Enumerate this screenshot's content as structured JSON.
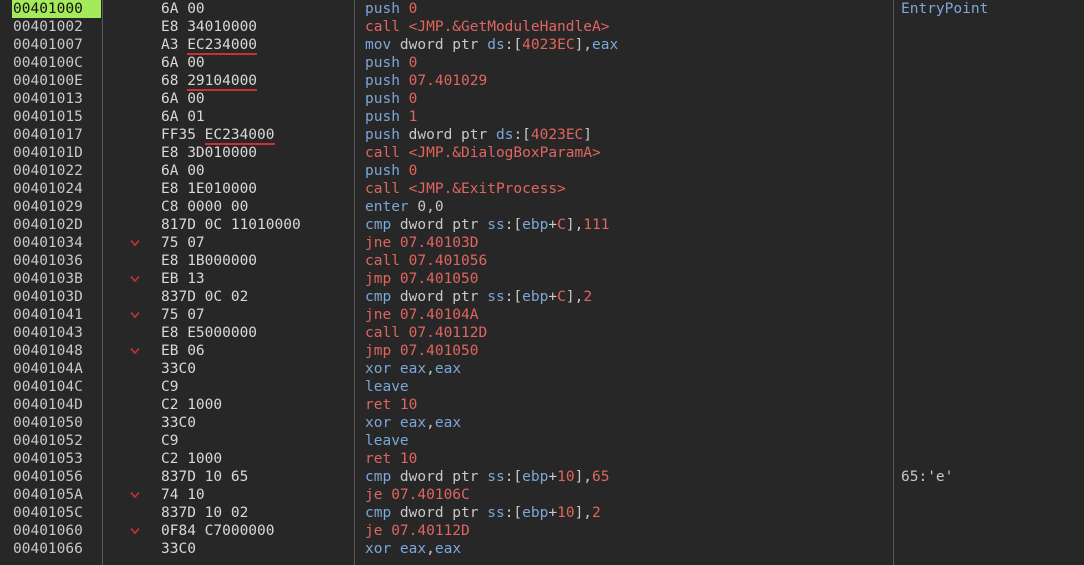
{
  "rows": [
    {
      "addr": "00401000",
      "selected": true,
      "arrow": "",
      "bytes": [
        {
          "t": "6A 00"
        }
      ],
      "instr": [
        {
          "t": "push ",
          "c": "t-mn-blue"
        },
        {
          "t": "0",
          "c": "t-num"
        }
      ],
      "comment": "EntryPoint",
      "comment_class": "ep"
    },
    {
      "addr": "00401002",
      "arrow": "",
      "bytes": [
        {
          "t": "E8 34010000"
        }
      ],
      "instr": [
        {
          "t": "call ",
          "c": "t-mn-red"
        },
        {
          "t": "<JMP.&GetModuleHandleA>",
          "c": "t-sym"
        }
      ],
      "comment": ""
    },
    {
      "addr": "00401007",
      "arrow": "",
      "bytes": [
        {
          "t": "A3 "
        },
        {
          "t": "EC234000",
          "u": true
        }
      ],
      "instr": [
        {
          "t": "mov ",
          "c": "t-mn-blue"
        },
        {
          "t": "dword ptr ",
          "c": "t-kw"
        },
        {
          "t": "ds",
          "c": "t-seg"
        },
        {
          "t": ":[",
          "c": "t-plain"
        },
        {
          "t": "4023EC",
          "c": "t-num"
        },
        {
          "t": "],",
          "c": "t-plain"
        },
        {
          "t": "eax",
          "c": "t-reg"
        }
      ],
      "comment": ""
    },
    {
      "addr": "0040100C",
      "arrow": "",
      "bytes": [
        {
          "t": "6A 00"
        }
      ],
      "instr": [
        {
          "t": "push ",
          "c": "t-mn-blue"
        },
        {
          "t": "0",
          "c": "t-num"
        }
      ],
      "comment": ""
    },
    {
      "addr": "0040100E",
      "arrow": "",
      "bytes": [
        {
          "t": "68 "
        },
        {
          "t": "29104000",
          "u": true
        }
      ],
      "instr": [
        {
          "t": "push ",
          "c": "t-mn-blue"
        },
        {
          "t": "07.401029",
          "c": "t-num"
        }
      ],
      "comment": ""
    },
    {
      "addr": "00401013",
      "arrow": "",
      "bytes": [
        {
          "t": "6A 00"
        }
      ],
      "instr": [
        {
          "t": "push ",
          "c": "t-mn-blue"
        },
        {
          "t": "0",
          "c": "t-num"
        }
      ],
      "comment": ""
    },
    {
      "addr": "00401015",
      "arrow": "",
      "bytes": [
        {
          "t": "6A 01"
        }
      ],
      "instr": [
        {
          "t": "push ",
          "c": "t-mn-blue"
        },
        {
          "t": "1",
          "c": "t-num"
        }
      ],
      "comment": ""
    },
    {
      "addr": "00401017",
      "arrow": "",
      "bytes": [
        {
          "t": "FF35 "
        },
        {
          "t": "EC234000",
          "u": true
        }
      ],
      "instr": [
        {
          "t": "push ",
          "c": "t-mn-blue"
        },
        {
          "t": "dword ptr ",
          "c": "t-kw"
        },
        {
          "t": "ds",
          "c": "t-seg"
        },
        {
          "t": ":[",
          "c": "t-plain"
        },
        {
          "t": "4023EC",
          "c": "t-num"
        },
        {
          "t": "]",
          "c": "t-plain"
        }
      ],
      "comment": ""
    },
    {
      "addr": "0040101D",
      "arrow": "",
      "bytes": [
        {
          "t": "E8 3D010000"
        }
      ],
      "instr": [
        {
          "t": "call ",
          "c": "t-mn-red"
        },
        {
          "t": "<JMP.&DialogBoxParamA>",
          "c": "t-sym"
        }
      ],
      "comment": ""
    },
    {
      "addr": "00401022",
      "arrow": "",
      "bytes": [
        {
          "t": "6A 00"
        }
      ],
      "instr": [
        {
          "t": "push ",
          "c": "t-mn-blue"
        },
        {
          "t": "0",
          "c": "t-num"
        }
      ],
      "comment": ""
    },
    {
      "addr": "00401024",
      "arrow": "",
      "bytes": [
        {
          "t": "E8 1E010000"
        }
      ],
      "instr": [
        {
          "t": "call ",
          "c": "t-mn-red"
        },
        {
          "t": "<JMP.&ExitProcess>",
          "c": "t-sym"
        }
      ],
      "comment": ""
    },
    {
      "addr": "00401029",
      "arrow": "",
      "bytes": [
        {
          "t": "C8 0000 00"
        }
      ],
      "instr": [
        {
          "t": "enter ",
          "c": "t-mn-blue"
        },
        {
          "t": "0,0",
          "c": "t-plain"
        }
      ],
      "comment": ""
    },
    {
      "addr": "0040102D",
      "arrow": "",
      "bytes": [
        {
          "t": "817D 0C 11010000"
        }
      ],
      "instr": [
        {
          "t": "cmp ",
          "c": "t-mn-blue"
        },
        {
          "t": "dword ptr ",
          "c": "t-kw"
        },
        {
          "t": "ss",
          "c": "t-seg"
        },
        {
          "t": ":[",
          "c": "t-plain"
        },
        {
          "t": "ebp",
          "c": "t-reg"
        },
        {
          "t": "+",
          "c": "t-plain"
        },
        {
          "t": "C",
          "c": "t-num"
        },
        {
          "t": "],",
          "c": "t-plain"
        },
        {
          "t": "111",
          "c": "t-num"
        }
      ],
      "comment": ""
    },
    {
      "addr": "00401034",
      "arrow": "v",
      "bytes": [
        {
          "t": "75 07"
        }
      ],
      "instr": [
        {
          "t": "jne ",
          "c": "t-mn-red"
        },
        {
          "t": "07.40103D",
          "c": "t-num"
        }
      ],
      "comment": ""
    },
    {
      "addr": "00401036",
      "arrow": "",
      "bytes": [
        {
          "t": "E8 1B000000"
        }
      ],
      "instr": [
        {
          "t": "call ",
          "c": "t-mn-red"
        },
        {
          "t": "07.401056",
          "c": "t-num"
        }
      ],
      "comment": ""
    },
    {
      "addr": "0040103B",
      "arrow": "v",
      "bytes": [
        {
          "t": "EB 13"
        }
      ],
      "instr": [
        {
          "t": "jmp ",
          "c": "t-mn-red"
        },
        {
          "t": "07.401050",
          "c": "t-num"
        }
      ],
      "comment": ""
    },
    {
      "addr": "0040103D",
      "arrow": "",
      "bytes": [
        {
          "t": "837D 0C 02"
        }
      ],
      "instr": [
        {
          "t": "cmp ",
          "c": "t-mn-blue"
        },
        {
          "t": "dword ptr ",
          "c": "t-kw"
        },
        {
          "t": "ss",
          "c": "t-seg"
        },
        {
          "t": ":[",
          "c": "t-plain"
        },
        {
          "t": "ebp",
          "c": "t-reg"
        },
        {
          "t": "+",
          "c": "t-plain"
        },
        {
          "t": "C",
          "c": "t-num"
        },
        {
          "t": "],",
          "c": "t-plain"
        },
        {
          "t": "2",
          "c": "t-num"
        }
      ],
      "comment": ""
    },
    {
      "addr": "00401041",
      "arrow": "v",
      "bytes": [
        {
          "t": "75 07"
        }
      ],
      "instr": [
        {
          "t": "jne ",
          "c": "t-mn-red"
        },
        {
          "t": "07.40104A",
          "c": "t-num"
        }
      ],
      "comment": ""
    },
    {
      "addr": "00401043",
      "arrow": "",
      "bytes": [
        {
          "t": "E8 E5000000"
        }
      ],
      "instr": [
        {
          "t": "call ",
          "c": "t-mn-red"
        },
        {
          "t": "07.40112D",
          "c": "t-num"
        }
      ],
      "comment": ""
    },
    {
      "addr": "00401048",
      "arrow": "v",
      "bytes": [
        {
          "t": "EB 06"
        }
      ],
      "instr": [
        {
          "t": "jmp ",
          "c": "t-mn-red"
        },
        {
          "t": "07.401050",
          "c": "t-num"
        }
      ],
      "comment": ""
    },
    {
      "addr": "0040104A",
      "arrow": "",
      "bytes": [
        {
          "t": "33C0"
        }
      ],
      "instr": [
        {
          "t": "xor ",
          "c": "t-mn-blue"
        },
        {
          "t": "eax",
          "c": "t-reg"
        },
        {
          "t": ",",
          "c": "t-plain"
        },
        {
          "t": "eax",
          "c": "t-reg"
        }
      ],
      "comment": ""
    },
    {
      "addr": "0040104C",
      "arrow": "",
      "bytes": [
        {
          "t": "C9"
        }
      ],
      "instr": [
        {
          "t": "leave",
          "c": "t-mn-blue"
        }
      ],
      "comment": ""
    },
    {
      "addr": "0040104D",
      "arrow": "",
      "bytes": [
        {
          "t": "C2 1000"
        }
      ],
      "instr": [
        {
          "t": "ret ",
          "c": "t-mn-red"
        },
        {
          "t": "10",
          "c": "t-num"
        }
      ],
      "comment": ""
    },
    {
      "addr": "00401050",
      "arrow": "",
      "bytes": [
        {
          "t": "33C0"
        }
      ],
      "instr": [
        {
          "t": "xor ",
          "c": "t-mn-blue"
        },
        {
          "t": "eax",
          "c": "t-reg"
        },
        {
          "t": ",",
          "c": "t-plain"
        },
        {
          "t": "eax",
          "c": "t-reg"
        }
      ],
      "comment": ""
    },
    {
      "addr": "00401052",
      "arrow": "",
      "bytes": [
        {
          "t": "C9"
        }
      ],
      "instr": [
        {
          "t": "leave",
          "c": "t-mn-blue"
        }
      ],
      "comment": ""
    },
    {
      "addr": "00401053",
      "arrow": "",
      "bytes": [
        {
          "t": "C2 1000"
        }
      ],
      "instr": [
        {
          "t": "ret ",
          "c": "t-mn-red"
        },
        {
          "t": "10",
          "c": "t-num"
        }
      ],
      "comment": ""
    },
    {
      "addr": "00401056",
      "arrow": "",
      "bytes": [
        {
          "t": "837D 10 65"
        }
      ],
      "instr": [
        {
          "t": "cmp ",
          "c": "t-mn-blue"
        },
        {
          "t": "dword ptr ",
          "c": "t-kw"
        },
        {
          "t": "ss",
          "c": "t-seg"
        },
        {
          "t": ":[",
          "c": "t-plain"
        },
        {
          "t": "ebp",
          "c": "t-reg"
        },
        {
          "t": "+",
          "c": "t-plain"
        },
        {
          "t": "10",
          "c": "t-num"
        },
        {
          "t": "],",
          "c": "t-plain"
        },
        {
          "t": "65",
          "c": "t-num"
        }
      ],
      "comment": "65:'e'"
    },
    {
      "addr": "0040105A",
      "arrow": "v",
      "bytes": [
        {
          "t": "74 10"
        }
      ],
      "instr": [
        {
          "t": "je ",
          "c": "t-mn-red"
        },
        {
          "t": "07.40106C",
          "c": "t-num"
        }
      ],
      "comment": ""
    },
    {
      "addr": "0040105C",
      "arrow": "",
      "bytes": [
        {
          "t": "837D 10 02"
        }
      ],
      "instr": [
        {
          "t": "cmp ",
          "c": "t-mn-blue"
        },
        {
          "t": "dword ptr ",
          "c": "t-kw"
        },
        {
          "t": "ss",
          "c": "t-seg"
        },
        {
          "t": ":[",
          "c": "t-plain"
        },
        {
          "t": "ebp",
          "c": "t-reg"
        },
        {
          "t": "+",
          "c": "t-plain"
        },
        {
          "t": "10",
          "c": "t-num"
        },
        {
          "t": "],",
          "c": "t-plain"
        },
        {
          "t": "2",
          "c": "t-num"
        }
      ],
      "comment": ""
    },
    {
      "addr": "00401060",
      "arrow": "v",
      "bytes": [
        {
          "t": "0F84 C7000000"
        }
      ],
      "instr": [
        {
          "t": "je ",
          "c": "t-mn-red"
        },
        {
          "t": "07.40112D",
          "c": "t-num"
        }
      ],
      "comment": ""
    },
    {
      "addr": "00401066",
      "arrow": "",
      "bytes": [
        {
          "t": "33C0"
        }
      ],
      "instr": [
        {
          "t": "xor ",
          "c": "t-mn-blue"
        },
        {
          "t": "eax",
          "c": "t-reg"
        },
        {
          "t": ",",
          "c": "t-plain"
        },
        {
          "t": "eax",
          "c": "t-reg"
        }
      ],
      "comment": ""
    }
  ],
  "icons": {
    "jump_arrow": "chevron-down-icon"
  },
  "colors": {
    "background": "#272727",
    "selection": "#a5ea5a",
    "call_jump": "#e0655f",
    "mnemonic": "#7ba7d9",
    "underline": "#c83232"
  }
}
